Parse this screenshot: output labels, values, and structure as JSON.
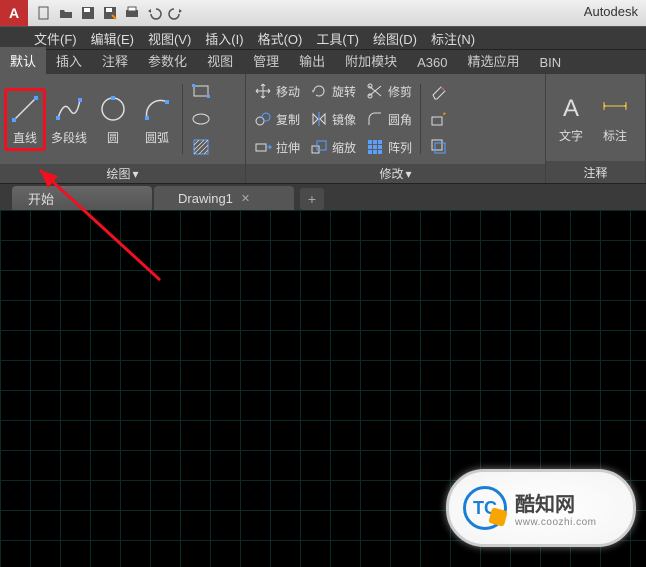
{
  "titlebar": {
    "product": "Autodesk"
  },
  "menubar": [
    "文件(F)",
    "编辑(E)",
    "视图(V)",
    "插入(I)",
    "格式(O)",
    "工具(T)",
    "绘图(D)",
    "标注(N)"
  ],
  "ribbon_tabs": [
    "默认",
    "插入",
    "注释",
    "参数化",
    "视图",
    "管理",
    "输出",
    "附加模块",
    "A360",
    "精选应用",
    "BIN"
  ],
  "ribbon_active_tab": "默认",
  "panels": {
    "draw": {
      "title": "绘图",
      "line": "直线",
      "polyline": "多段线",
      "circle": "圆",
      "arc": "圆弧"
    },
    "modify": {
      "title": "修改",
      "move": "移动",
      "copy": "复制",
      "stretch": "拉伸",
      "rotate": "旋转",
      "mirror": "镜像",
      "scale": "缩放",
      "trim": "修剪",
      "fillet": "圆角",
      "array": "阵列"
    },
    "annotation": {
      "title": "注释",
      "text": "文字",
      "annot": "标注"
    }
  },
  "doctabs": {
    "start": "开始",
    "drawing": "Drawing1"
  },
  "watermark": {
    "brand": "酷知网",
    "url": "www.coozhi.com",
    "logo_text": "TC"
  }
}
